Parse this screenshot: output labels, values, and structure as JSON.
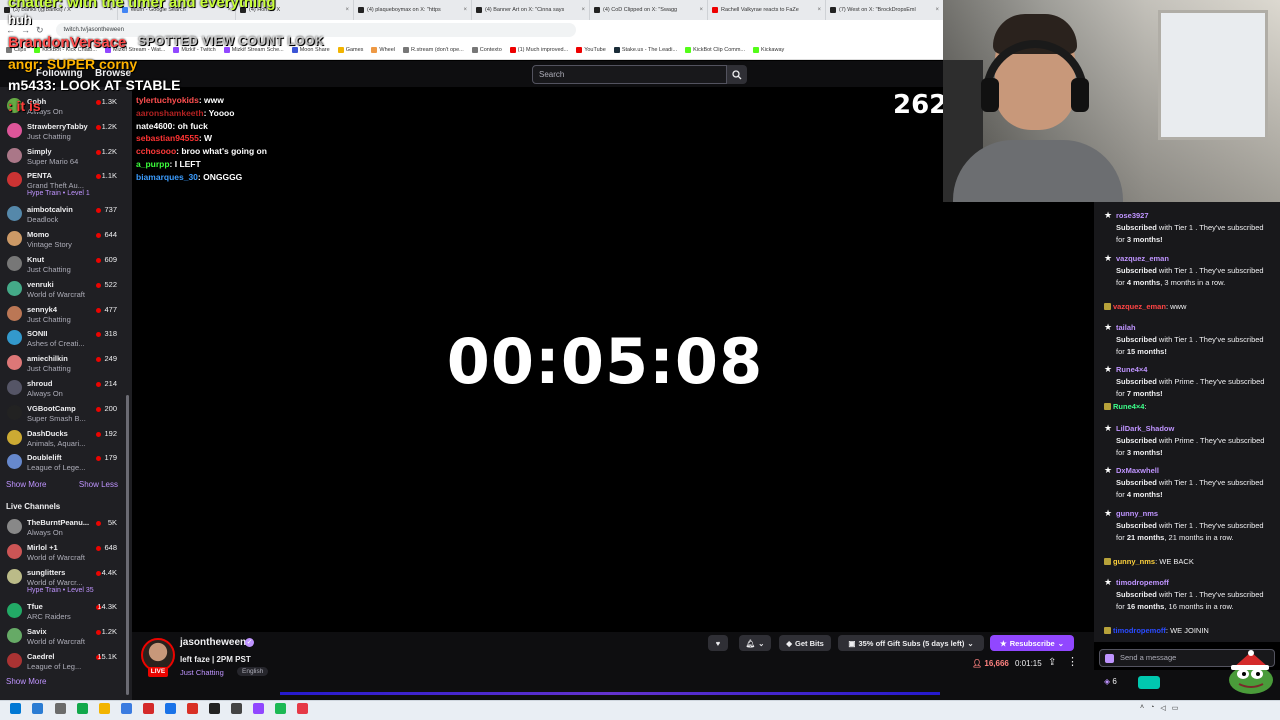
{
  "browser": {
    "tabs": [
      {
        "label": "(3) Banks (@Banks) / X"
      },
      {
        "label": "elium - Google Search"
      },
      {
        "label": "(4) Home / X"
      },
      {
        "label": "(4) plaqueboymax on X: \"https"
      },
      {
        "label": "(4) Banner Art on X: \"Cinna says"
      },
      {
        "label": "(4) CoD Clipped on X: \"Swagg"
      },
      {
        "label": "Rachell Valkyrae reacts to FaZe"
      },
      {
        "label": "(7) West on X: \"BrockDropsEml"
      }
    ],
    "url": "twitch.tv/jasontheween",
    "bookmarks": [
      "Clips",
      "KickBot - Kick Chatb...",
      "Mizkif Stream - Wat...",
      "Mizkif - Twitch",
      "Mizkif Stream Sche...",
      "Moon Share",
      "Games",
      "Wheel",
      "R.stream (don't ope...",
      "Contexto",
      "(1) Much improved...",
      "YouTube",
      "Stake.us - The Leadi...",
      "KickBot Clip Comm...",
      "Kickaway"
    ]
  },
  "overlay": {
    "line1": "chatter: with the timer and everything",
    "line2": "huh",
    "line3": "BrandonVersace",
    "line3b": "SPOTTED VIEW COUNT LOOK",
    "line4": "angr: SUPER corny",
    "line5": "m5433: LOOK AT STABLE",
    "line6": ": it is"
  },
  "topnav": {
    "following": "Following",
    "browse": "Browse",
    "search_placeholder": "Search"
  },
  "sidebar": {
    "followed": [
      {
        "name": "Cobh",
        "game": "Always On",
        "viewers": "1.3K"
      },
      {
        "name": "StrawberryTabby",
        "game": "Just Chatting",
        "viewers": "1.2K"
      },
      {
        "name": "Simply",
        "game": "Super Mario 64",
        "viewers": "1.2K"
      },
      {
        "name": "PENTA",
        "game": "Grand Theft Au...",
        "viewers": "1.1K",
        "hype": "Hype Train • Level 1"
      },
      {
        "name": "aimbotcalvin",
        "game": "Deadlock",
        "viewers": "737"
      },
      {
        "name": "Momo",
        "game": "Vintage Story",
        "viewers": "644"
      },
      {
        "name": "Knut",
        "game": "Just Chatting",
        "viewers": "609"
      },
      {
        "name": "venruki",
        "game": "World of Warcraft",
        "viewers": "522"
      },
      {
        "name": "sennyk4",
        "game": "Just Chatting",
        "viewers": "477"
      },
      {
        "name": "SONII",
        "game": "Ashes of Creati...",
        "viewers": "318"
      },
      {
        "name": "amiechilkin",
        "game": "Just Chatting",
        "viewers": "249"
      },
      {
        "name": "shroud",
        "game": "Always On",
        "viewers": "214"
      },
      {
        "name": "VGBootCamp",
        "game": "Super Smash B...",
        "viewers": "200"
      },
      {
        "name": "DashDucks",
        "game": "Animals, Aquari...",
        "viewers": "192"
      },
      {
        "name": "Doublelift",
        "game": "League of Lege...",
        "viewers": "179"
      }
    ],
    "show_more": "Show More",
    "show_less": "Show Less",
    "live_title": "Live Channels",
    "live": [
      {
        "name": "TheBurntPeanu...",
        "game": "Always On",
        "viewers": "5K"
      },
      {
        "name": "Mirlol +1",
        "game": "World of Warcraft",
        "viewers": "648"
      },
      {
        "name": "sunglitters",
        "game": "World of Warcr...",
        "viewers": "4.4K",
        "hype": "Hype Train • Level 35"
      },
      {
        "name": "Tfue",
        "game": "ARC Raiders",
        "viewers": "14.3K"
      },
      {
        "name": "Savix",
        "game": "World of Warcraft",
        "viewers": "1.2K"
      },
      {
        "name": "Caedrel",
        "game": "League of Leg...",
        "viewers": "15.1K"
      }
    ],
    "show_more_2": "Show More"
  },
  "video_chat": [
    {
      "user": "tylertuchyokids",
      "msg": ": www",
      "color": "#ff4f4f"
    },
    {
      "user": "aaronshamkeeth",
      "msg": ": Yoooo",
      "color": "#b22222"
    },
    {
      "user": "nate4600",
      "msg": ": oh fuck",
      "color": "#ffffff"
    },
    {
      "user": "sebastian94555",
      "msg": ": W",
      "color": "#ff3333"
    },
    {
      "user": "cchosooo",
      "msg": ": broo what's going on",
      "color": "#ff3b3b"
    },
    {
      "user": "a_purpp",
      "msg": ": I LEFT",
      "color": "#3cff3c"
    },
    {
      "user": "biamarques_30",
      "msg": ": ONGGGG",
      "color": "#3c9dff"
    }
  ],
  "timer": "00:05:08",
  "corner_number": "262",
  "right_chat": {
    "subs": [
      {
        "user": "rose3927",
        "color": "#bf94ff",
        "text_a": "Subscribed",
        "text_b": " with Tier 1 . They've subscribed for ",
        "months": "3 months!"
      },
      {
        "user": "vazquez_eman",
        "color": "#bf94ff",
        "text_a": "Subscribed",
        "text_b": " with Tier 1 . They've subscribed for ",
        "months": "4 months",
        "extra": ", 3 months in a row."
      },
      {
        "user": "tailah",
        "color": "#bf94ff",
        "text_a": "Subscribed",
        "text_b": " with Tier 1 . They've subscribed for ",
        "months": "15 months!"
      },
      {
        "user": "Rune4×4",
        "color": "#bf94ff",
        "text_a": "Subscribed",
        "text_b": " with Prime . They've subscribed for ",
        "months": "7 months!"
      },
      {
        "user": "LilDark_Shadow",
        "color": "#bf94ff",
        "text_a": "Subscribed",
        "text_b": " with Prime . They've subscribed for ",
        "months": "3 months!"
      },
      {
        "user": "DxMaxwhell",
        "color": "#bf94ff",
        "text_a": "Subscribed",
        "text_b": " with Tier 1 . They've subscribed for ",
        "months": "4 months!"
      },
      {
        "user": "gunny_nms",
        "color": "#bf94ff",
        "text_a": "Subscribed",
        "text_b": " with Tier 1 . They've subscribed for ",
        "months": "21 months",
        "extra": ", 21 months in a row."
      },
      {
        "user": "timodropemoff",
        "color": "#bf94ff",
        "text_a": "Subscribed",
        "text_b": " with Tier 1 . They've subscribed for ",
        "months": "16 months",
        "extra": ", 16 months in a row."
      }
    ],
    "lines": [
      {
        "user": "vazquez_eman",
        "msg": ": www",
        "color": "#ff4444"
      },
      {
        "user": "Rune4×4",
        "msg": ":",
        "color": "#3cff8a"
      },
      {
        "user": "gunny_nms",
        "msg": ": WE BACK",
        "color": "#ffd23c"
      },
      {
        "user": "timodropemoff",
        "msg": ": WE JOININ",
        "color": "#2a4bff"
      }
    ],
    "input_placeholder": "Send a message",
    "points": "6"
  },
  "stream": {
    "streamer": "jasontheween",
    "title": "left faze | 2PM PST",
    "category": "Just Chatting",
    "tag": "English",
    "live": "LIVE",
    "get_bits": "Get Bits",
    "gift_promo": "35% off Gift Subs (5 days left)",
    "resubscribe": "Resubscribe",
    "viewers": "16,666",
    "uptime": "0:01:15"
  }
}
